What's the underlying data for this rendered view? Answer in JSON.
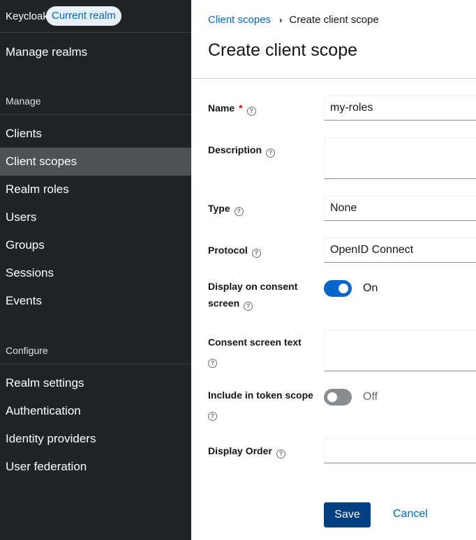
{
  "sidebar": {
    "brand": "Keycloak",
    "realm_badge": "Current realm",
    "manage_realms": "Manage realms",
    "manage_section": "Manage",
    "manage_items": [
      {
        "label": "Clients"
      },
      {
        "label": "Client scopes",
        "active": true
      },
      {
        "label": "Realm roles"
      },
      {
        "label": "Users"
      },
      {
        "label": "Groups"
      },
      {
        "label": "Sessions"
      },
      {
        "label": "Events"
      }
    ],
    "configure_section": "Configure",
    "configure_items": [
      {
        "label": "Realm settings"
      },
      {
        "label": "Authentication"
      },
      {
        "label": "Identity providers"
      },
      {
        "label": "User federation"
      }
    ]
  },
  "breadcrumb": {
    "link": "Client scopes",
    "current": "Create client scope"
  },
  "page": {
    "title": "Create client scope"
  },
  "form": {
    "name": {
      "label": "Name",
      "required": "*",
      "value": "my-roles"
    },
    "description": {
      "label": "Description",
      "value": ""
    },
    "type": {
      "label": "Type",
      "value": "None"
    },
    "protocol": {
      "label": "Protocol",
      "value": "OpenID Connect"
    },
    "display_on_consent": {
      "label_line1": "Display on consent",
      "label_line2": "screen",
      "state": "On",
      "on": true
    },
    "consent_text": {
      "label": "Consent screen text",
      "value": ""
    },
    "include_in_token_scope": {
      "label": "Include in token scope",
      "state": "Off",
      "on": false
    },
    "display_order": {
      "label": "Display Order",
      "value": ""
    }
  },
  "actions": {
    "save": "Save",
    "cancel": "Cancel"
  },
  "icons": {
    "help": "?"
  },
  "colors": {
    "sidebar_bg": "#212427",
    "active_item": "#4f5255",
    "link": "#0066cc",
    "primary_button": "#004080",
    "switch_on": "#0066cc",
    "switch_off": "#8a8d90",
    "required": "#c9190b"
  }
}
